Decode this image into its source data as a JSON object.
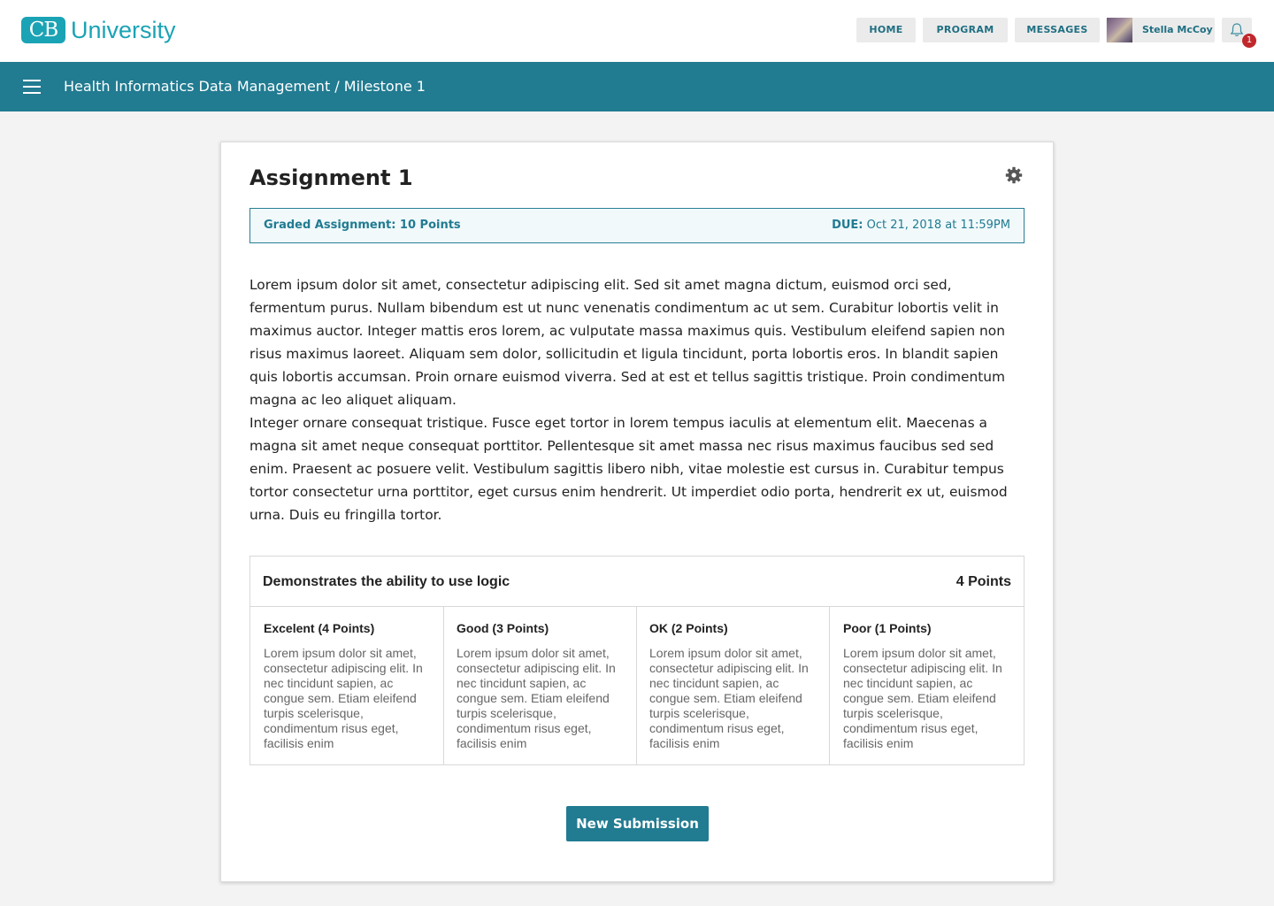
{
  "header": {
    "logo_mark": "CB",
    "logo_text": "University",
    "nav": [
      "HOME",
      "PROGRAM",
      "MESSAGES"
    ],
    "user_name": "Stella McCoy",
    "notification_count": "1",
    "icons": [
      "avatar",
      "bell-icon"
    ]
  },
  "subbar": {
    "breadcrumb": "Health Informatics Data Management / Milestone 1",
    "icons": [
      "menu-icon"
    ]
  },
  "assignment": {
    "title": "Assignment 1",
    "graded_label": "Graded Assignment: 10 Points",
    "due_label": "DUE:",
    "due_value": "Oct 21, 2018 at 11:59PM",
    "paragraphs": [
      "Lorem ipsum dolor sit amet, consectetur adipiscing elit. Sed sit amet magna dictum, euismod orci sed, fermentum purus. Nullam bibendum est ut nunc venenatis condimentum ac ut sem. Curabitur lobortis velit in maximus auctor. Integer mattis eros lorem, ac vulputate massa maximus quis. Vestibulum eleifend sapien non risus maximus laoreet. Aliquam sem dolor, sollicitudin et ligula tincidunt, porta lobortis eros. In blandit sapien quis lobortis accumsan. Proin ornare euismod viverra. Sed at est et tellus sagittis tristique. Proin condimentum magna ac leo aliquet aliquam.",
      "Integer ornare consequat tristique. Fusce eget tortor in lorem tempus iaculis at elementum elit. Maecenas a magna sit amet neque consequat porttitor. Pellentesque sit amet massa nec risus maximus faucibus sed sed enim. Praesent ac posuere velit. Vestibulum sagittis libero nibh, vitae molestie est cursus in. Curabitur tempus tortor consectetur urna porttitor, eget cursus enim hendrerit. Ut imperdiet odio porta, hendrerit ex ut, euismod urna. Duis eu fringilla tortor."
    ],
    "icons": [
      "gear-icon"
    ]
  },
  "rubric": {
    "title": "Demonstrates the ability to use logic",
    "points": "4 Points",
    "criteria": [
      {
        "label": "Excelent (4 Points)",
        "text": "Lorem ipsum dolor sit amet, consectetur adipiscing elit. In nec tincidunt sapien, ac congue sem. Etiam eleifend turpis scelerisque, condimentum risus eget, facilisis enim"
      },
      {
        "label": "Good (3 Points)",
        "text": "Lorem ipsum dolor sit amet, consectetur adipiscing elit. In nec tincidunt sapien, ac congue sem. Etiam eleifend turpis scelerisque, condimentum risus eget, facilisis enim"
      },
      {
        "label": "OK (2 Points)",
        "text": "Lorem ipsum dolor sit amet, consectetur adipiscing elit. In nec tincidunt sapien, ac congue sem. Etiam eleifend turpis scelerisque, condimentum risus eget, facilisis enim"
      },
      {
        "label": "Poor (1 Points)",
        "text": "Lorem ipsum dolor sit amet, consectetur adipiscing elit. In nec tincidunt sapien, ac congue sem. Etiam eleifend turpis scelerisque, condimentum risus eget, facilisis enim"
      }
    ]
  },
  "actions": {
    "new_submission": "New Submission"
  },
  "colors": {
    "brand_teal": "#217b91",
    "logo_teal": "#1aa3b5",
    "badge_red": "#c0282b"
  }
}
